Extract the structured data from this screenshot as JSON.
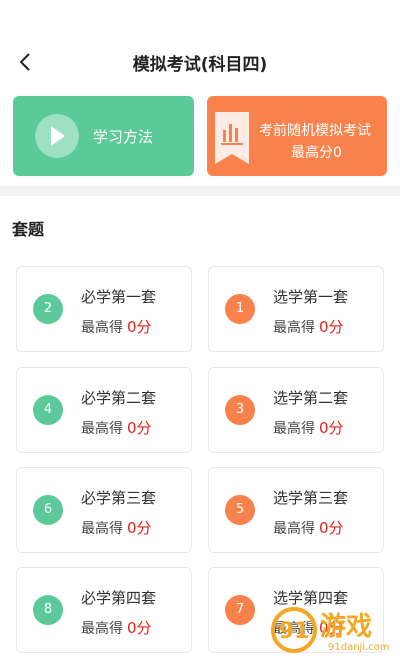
{
  "header": {
    "title": "模拟考试(科目四)",
    "back_icon": "back-arrow-icon"
  },
  "hero": {
    "study": {
      "label": "学习方法",
      "icon": "play-icon",
      "color": "#5cc99a"
    },
    "random": {
      "line1": "考前随机模拟考试",
      "line2": "最高分0",
      "icon": "exam-badge-icon",
      "color": "#f8814c"
    }
  },
  "section": {
    "title": "套题"
  },
  "score_prefix": "最高得",
  "cards": [
    {
      "number": "2",
      "title": "必学第一套",
      "score": "0分",
      "color": "green"
    },
    {
      "number": "1",
      "title": "选学第一套",
      "score": "0分",
      "color": "orange"
    },
    {
      "number": "4",
      "title": "必学第二套",
      "score": "0分",
      "color": "green"
    },
    {
      "number": "3",
      "title": "选学第二套",
      "score": "0分",
      "color": "orange"
    },
    {
      "number": "6",
      "title": "必学第三套",
      "score": "0分",
      "color": "green"
    },
    {
      "number": "5",
      "title": "选学第三套",
      "score": "0分",
      "color": "orange"
    },
    {
      "number": "8",
      "title": "必学第四套",
      "score": "0分",
      "color": "green"
    },
    {
      "number": "7",
      "title": "选学第四套",
      "score": "0分",
      "color": "orange"
    }
  ],
  "watermark": {
    "brand": "游戏",
    "url": "91danji.com",
    "logo_text": "91"
  },
  "colors": {
    "green": "#5cc99a",
    "orange": "#f8814c",
    "score_red": "#e0241f"
  }
}
